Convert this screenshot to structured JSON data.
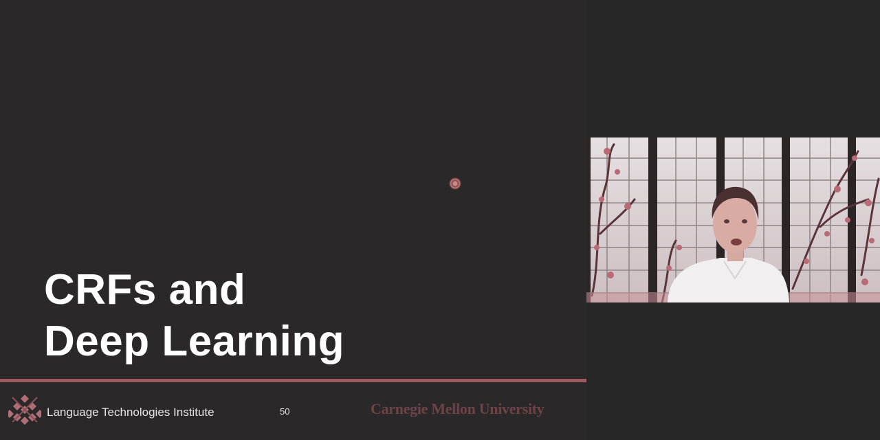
{
  "slide": {
    "title_line1": "CRFs and",
    "title_line2": "Deep Learning",
    "institute": "Language Technologies Institute",
    "page_number": "50",
    "university": "Carnegie Mellon University"
  },
  "colors": {
    "slide_background": "#2a2828",
    "accent_rule": "#9c5a5f",
    "university_text": "#6e4348",
    "window_background": "#272727"
  },
  "video_feed": {
    "icon": "person-webcam-video"
  }
}
